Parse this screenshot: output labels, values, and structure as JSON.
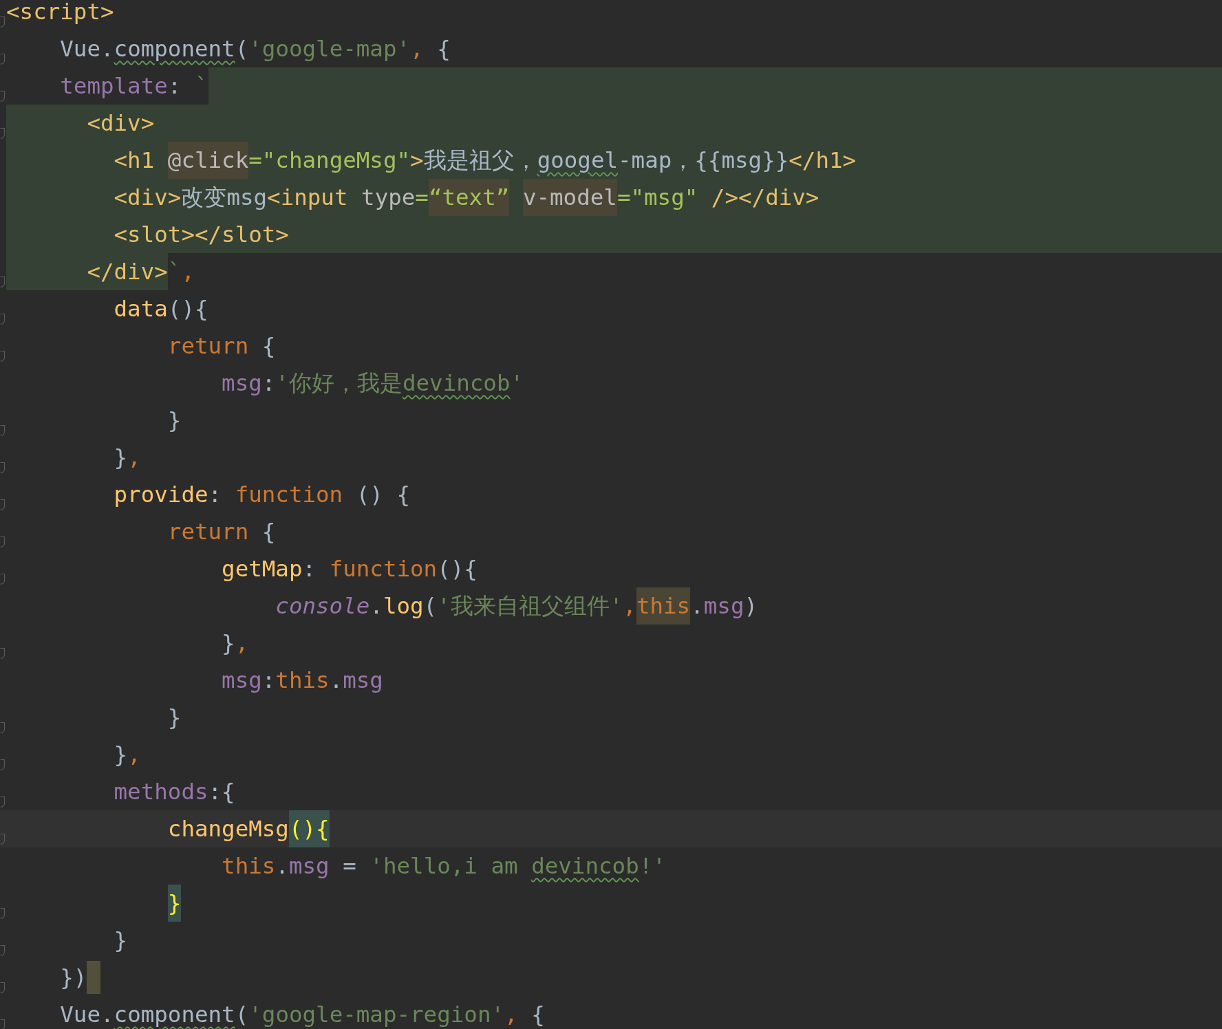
{
  "lines": [
    {
      "fold": true,
      "tokens": [
        {
          "text": "<script>",
          "kind": "tag"
        }
      ]
    },
    {
      "fold": true,
      "tokens": [
        {
          "text": "    Vue.",
          "kind": "plain"
        },
        {
          "text": "component",
          "kind": "plain",
          "typo": true
        },
        {
          "text": "(",
          "kind": "plain"
        },
        {
          "text": "'google-map'",
          "kind": "jsstr"
        },
        {
          "text": ", ",
          "kind": "kw"
        },
        {
          "text": "{",
          "kind": "plain"
        }
      ]
    },
    {
      "fold": true,
      "injected_to_end": true,
      "tokens": [
        {
          "text": "    template",
          "kind": "prop"
        },
        {
          "text": ": ",
          "kind": "plain"
        },
        {
          "text": "`",
          "kind": "jsstr"
        }
      ]
    },
    {
      "fold": true,
      "injected_to_end": true,
      "tokens": [
        {
          "text": "      <div>",
          "kind": "tag",
          "injected": true
        }
      ]
    },
    {
      "fold": false,
      "injected_to_end": true,
      "tokens": [
        {
          "text": "        <h1 ",
          "kind": "tag",
          "injected": true
        },
        {
          "text": "@click",
          "kind": "attr",
          "warning": true
        },
        {
          "text": "=\"changeMsg\"",
          "kind": "str",
          "injected": true
        },
        {
          "text": ">",
          "kind": "tag",
          "injected": true
        },
        {
          "text": "我是祖父，",
          "kind": "plain",
          "injected": true
        },
        {
          "text": "googel",
          "kind": "plain",
          "injected": true,
          "typo": true
        },
        {
          "text": "-map，{{msg}}",
          "kind": "plain",
          "injected": true
        },
        {
          "text": "</h1>",
          "kind": "tag",
          "injected": true
        }
      ]
    },
    {
      "fold": false,
      "injected_to_end": true,
      "tokens": [
        {
          "text": "        <div>",
          "kind": "tag",
          "injected": true
        },
        {
          "text": "改变msg",
          "kind": "plain",
          "injected": true
        },
        {
          "text": "<input ",
          "kind": "tag",
          "injected": true
        },
        {
          "text": "type",
          "kind": "attr",
          "injected": true
        },
        {
          "text": "=",
          "kind": "str",
          "injected": true
        },
        {
          "text": "“text”",
          "kind": "str",
          "warning": true
        },
        {
          "text": " v-model",
          "kind": "attr",
          "warning": true
        },
        {
          "text": "=\"msg\"",
          "kind": "str",
          "injected": true
        },
        {
          "text": " /></div>",
          "kind": "tag",
          "injected": true
        }
      ]
    },
    {
      "fold": false,
      "injected_to_end": true,
      "tokens": [
        {
          "text": "        <slot></slot>",
          "kind": "tag",
          "injected": true
        }
      ]
    },
    {
      "fold": true,
      "tokens": [
        {
          "text": "      </div>",
          "kind": "tag",
          "injected": true
        },
        {
          "text": "`",
          "kind": "jsstr"
        },
        {
          "text": ",",
          "kind": "kw"
        }
      ]
    },
    {
      "fold": true,
      "tokens": [
        {
          "text": "        data",
          "kind": "fn"
        },
        {
          "text": "(){",
          "kind": "plain"
        }
      ]
    },
    {
      "fold": true,
      "tokens": [
        {
          "text": "            return",
          "kind": "kw"
        },
        {
          "text": " {",
          "kind": "plain"
        }
      ]
    },
    {
      "fold": false,
      "tokens": [
        {
          "text": "                msg",
          "kind": "prop"
        },
        {
          "text": ":",
          "kind": "plain"
        },
        {
          "text": "'你好，我是",
          "kind": "jsstr"
        },
        {
          "text": "devincob",
          "kind": "jsstr",
          "typo": true
        },
        {
          "text": "'",
          "kind": "jsstr"
        }
      ]
    },
    {
      "fold": true,
      "tokens": [
        {
          "text": "            }",
          "kind": "plain"
        }
      ]
    },
    {
      "fold": true,
      "tokens": [
        {
          "text": "        }",
          "kind": "plain"
        },
        {
          "text": ",",
          "kind": "kw"
        }
      ]
    },
    {
      "fold": true,
      "tokens": [
        {
          "text": "        provide",
          "kind": "fn"
        },
        {
          "text": ": ",
          "kind": "plain"
        },
        {
          "text": "function",
          "kind": "kw"
        },
        {
          "text": " () {",
          "kind": "plain"
        }
      ]
    },
    {
      "fold": true,
      "tokens": [
        {
          "text": "            return",
          "kind": "kw"
        },
        {
          "text": " {",
          "kind": "plain"
        }
      ]
    },
    {
      "fold": true,
      "tokens": [
        {
          "text": "                getMap",
          "kind": "fn"
        },
        {
          "text": ": ",
          "kind": "plain"
        },
        {
          "text": "function",
          "kind": "kw"
        },
        {
          "text": "(){",
          "kind": "plain"
        }
      ]
    },
    {
      "fold": false,
      "tokens": [
        {
          "text": "                    console",
          "kind": "italic"
        },
        {
          "text": ".",
          "kind": "plain"
        },
        {
          "text": "log",
          "kind": "fn"
        },
        {
          "text": "(",
          "kind": "plain"
        },
        {
          "text": "'我来自祖父组件'",
          "kind": "jsstr"
        },
        {
          "text": ",",
          "kind": "kw"
        },
        {
          "text": "this",
          "kind": "kw",
          "warning": true
        },
        {
          "text": ".",
          "kind": "plain"
        },
        {
          "text": "msg",
          "kind": "prop"
        },
        {
          "text": ")",
          "kind": "plain"
        }
      ]
    },
    {
      "fold": true,
      "tokens": [
        {
          "text": "                }",
          "kind": "plain"
        },
        {
          "text": ",",
          "kind": "kw"
        }
      ]
    },
    {
      "fold": false,
      "tokens": [
        {
          "text": "                msg",
          "kind": "prop"
        },
        {
          "text": ":",
          "kind": "plain"
        },
        {
          "text": "this",
          "kind": "kw"
        },
        {
          "text": ".",
          "kind": "plain"
        },
        {
          "text": "msg",
          "kind": "prop"
        }
      ]
    },
    {
      "fold": true,
      "tokens": [
        {
          "text": "            }",
          "kind": "plain"
        }
      ]
    },
    {
      "fold": true,
      "tokens": [
        {
          "text": "        }",
          "kind": "plain"
        },
        {
          "text": ",",
          "kind": "kw"
        }
      ]
    },
    {
      "fold": true,
      "tokens": [
        {
          "text": "        methods",
          "kind": "prop"
        },
        {
          "text": ":{",
          "kind": "plain"
        }
      ]
    },
    {
      "fold": true,
      "current": true,
      "tokens": [
        {
          "text": "            changeMsg",
          "kind": "fn"
        },
        {
          "text": "(){",
          "kind": "match",
          "brace_match": true
        }
      ]
    },
    {
      "fold": false,
      "tokens": [
        {
          "text": "                this",
          "kind": "kw"
        },
        {
          "text": ".",
          "kind": "plain"
        },
        {
          "text": "msg",
          "kind": "prop"
        },
        {
          "text": " = ",
          "kind": "plain"
        },
        {
          "text": "'hello,i am ",
          "kind": "jsstr"
        },
        {
          "text": "devincob",
          "kind": "jsstr",
          "typo": true
        },
        {
          "text": "!'",
          "kind": "jsstr"
        }
      ]
    },
    {
      "fold": true,
      "tokens": [
        {
          "text": "            }",
          "kind": "match",
          "brace_match": true
        }
      ]
    },
    {
      "fold": true,
      "tokens": [
        {
          "text": "        }",
          "kind": "plain"
        }
      ]
    },
    {
      "fold": true,
      "marker": true,
      "tokens": [
        {
          "text": "    })",
          "kind": "plain"
        }
      ]
    },
    {
      "fold": true,
      "tokens": [
        {
          "text": "    Vue.",
          "kind": "plain"
        },
        {
          "text": "component",
          "kind": "plain",
          "typo": true
        },
        {
          "text": "(",
          "kind": "plain"
        },
        {
          "text": "'google-map-region'",
          "kind": "jsstr"
        },
        {
          "text": ", ",
          "kind": "kw"
        },
        {
          "text": "{",
          "kind": "plain"
        }
      ]
    }
  ]
}
